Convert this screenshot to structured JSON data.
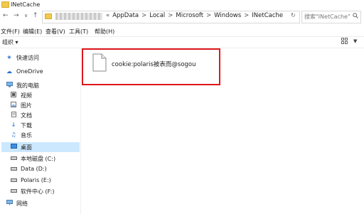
{
  "window": {
    "title": "INetCache"
  },
  "address": {
    "path": [
      "AppData",
      "Local",
      "Microsoft",
      "Windows",
      "INetCache"
    ],
    "sep": ">",
    "first_sep": "«",
    "refresh_glyph": "↻"
  },
  "search": {
    "placeholder": "搜索\"INetCache\"",
    "icon": "search-icon"
  },
  "menu": {
    "file": "文件(F)",
    "edit": "编辑(E)",
    "view": "查看(V)",
    "tools": "工具(T)",
    "help": "帮助(H)"
  },
  "toolbar": {
    "organize": "组织 ▾"
  },
  "sidebar": {
    "items": [
      {
        "label": "快速访问",
        "icon": "star-icon"
      },
      {
        "label": "OneDrive",
        "icon": "cloud-icon"
      },
      {
        "label": "我的电脑",
        "icon": "computer-icon"
      },
      {
        "label": "视频",
        "icon": "video-icon"
      },
      {
        "label": "图片",
        "icon": "picture-icon"
      },
      {
        "label": "文档",
        "icon": "document-icon"
      },
      {
        "label": "下载",
        "icon": "download-icon"
      },
      {
        "label": "音乐",
        "icon": "music-icon"
      },
      {
        "label": "桌面",
        "icon": "desktop-icon"
      },
      {
        "label": "本地磁盘 (C:)",
        "icon": "drive-icon"
      },
      {
        "label": "Data (D:)",
        "icon": "drive-icon"
      },
      {
        "label": "Polaris (E:)",
        "icon": "drive-icon"
      },
      {
        "label": "软件中心 (F:)",
        "icon": "drive-icon"
      },
      {
        "label": "网络",
        "icon": "network-icon"
      }
    ]
  },
  "files": [
    {
      "name": "cookie:polaris被表而@sogou",
      "icon": "file-icon"
    }
  ],
  "colors": {
    "highlight": "#e0161c",
    "selection": "#cce8ff",
    "folder": "#f1c94f"
  }
}
